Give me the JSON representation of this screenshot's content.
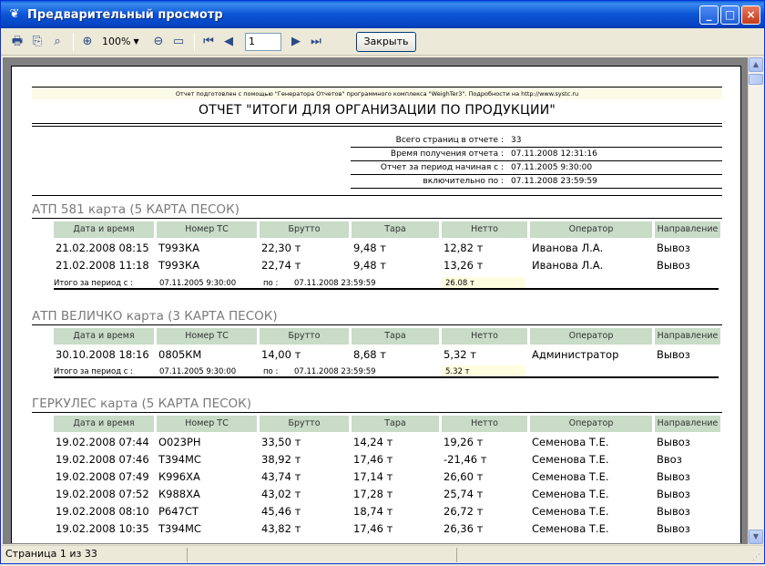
{
  "window": {
    "title": "Предварительный просмотр",
    "icon": "app-icon",
    "min": "_",
    "max": "□",
    "close": "×"
  },
  "toolbar": {
    "zoom": "100%",
    "page": "1",
    "close_label": "Закрыть",
    "icons": [
      "printer-icon",
      "export-icon",
      "find-icon",
      "zoom-in-icon",
      "zoom-out-icon",
      "page-view-icon",
      "first-page-icon",
      "prev-page-icon",
      "next-page-icon",
      "last-page-icon"
    ]
  },
  "report": {
    "credit": "Отчет подготовлен с помощью \"Генератора Отчетов\" программного комплекса \"WeighTer3\". Подробности на http://www.systc.ru",
    "title": "ОТЧЕТ \"ИТОГИ ДЛЯ ОРГАНИЗАЦИИ ПО ПРОДУКЦИИ\"",
    "meta": [
      {
        "label": "Всего страниц в отчете :",
        "value": "33"
      },
      {
        "label": "Время получения отчета :",
        "value": "07.11.2008 12:31:16"
      },
      {
        "label": "Отчет за период начиная с :",
        "value": "07.11.2005 9:30:00"
      },
      {
        "label": "включительно по :",
        "value": "07.11.2008 23:59:59"
      }
    ],
    "headers": [
      "Дата и время",
      "Номер ТС",
      "Брутто",
      "Тара",
      "Нетто",
      "Оператор",
      "Направление"
    ],
    "groups": [
      {
        "title": "АТП 581 карта (5 КАРТА ПЕСОК)",
        "rows": [
          [
            "21.02.2008 08:15",
            "Т993КА",
            "22,30 т",
            "9,48 т",
            "12,82 т",
            "Иванова Л.А.",
            "Вывоз"
          ],
          [
            "21.02.2008 11:18",
            "Т993КА",
            "22,74 т",
            "9,48 т",
            "13,26 т",
            "Иванова Л.А.",
            "Вывоз"
          ]
        ],
        "total": {
          "label": "Итого за период с :",
          "from": "07.11.2005 9:30:00",
          "to_label": "по :",
          "to": "07.11.2008 23:59:59",
          "sum": "26.08 т"
        }
      },
      {
        "title": "АТП ВЕЛИЧКО карта (3 КАРТА ПЕСОК)",
        "rows": [
          [
            "30.10.2008 18:16",
            "0805КМ",
            "14,00 т",
            "8,68 т",
            "5,32 т",
            "Администратор",
            "Вывоз"
          ]
        ],
        "total": {
          "label": "Итого за период с :",
          "from": "07.11.2005 9:30:00",
          "to_label": "по :",
          "to": "07.11.2008 23:59:59",
          "sum": "5.32 т"
        }
      },
      {
        "title": "ГЕРКУЛЕС карта (5 КАРТА ПЕСОК)",
        "rows": [
          [
            "19.02.2008 07:44",
            "О023РН",
            "33,50 т",
            "14,24 т",
            "19,26 т",
            "Семенова Т.Е.",
            "Вывоз"
          ],
          [
            "19.02.2008 07:46",
            "Т394МС",
            "38,92 т",
            "17,46 т",
            "-21,46 т",
            "Семенова Т.Е.",
            "Ввоз"
          ],
          [
            "19.02.2008 07:49",
            "К996ХА",
            "43,74 т",
            "17,14 т",
            "26,60 т",
            "Семенова Т.Е.",
            "Вывоз"
          ],
          [
            "19.02.2008 07:52",
            "К988ХА",
            "43,02 т",
            "17,28 т",
            "25,74 т",
            "Семенова Т.Е.",
            "Вывоз"
          ],
          [
            "19.02.2008 08:10",
            "Р647СТ",
            "45,46 т",
            "18,74 т",
            "26,72 т",
            "Семенова Т.Е.",
            "Вывоз"
          ],
          [
            "19.02.2008 10:35",
            "Т394МС",
            "43,82 т",
            "17,46 т",
            "26,36 т",
            "Семенова Т.Е.",
            "Вывоз"
          ]
        ]
      }
    ]
  },
  "status": {
    "text": "Страница 1 из 33"
  }
}
